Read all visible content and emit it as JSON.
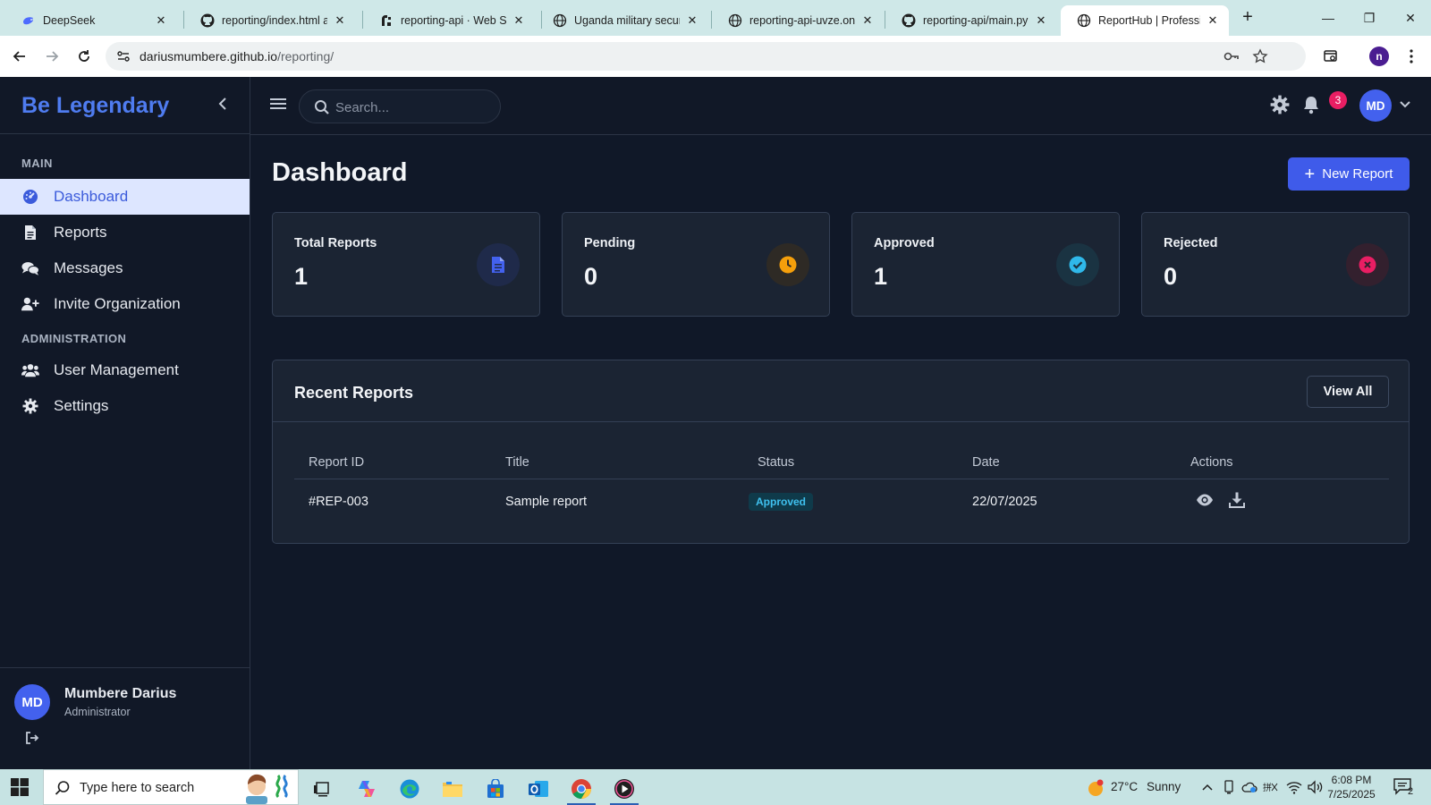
{
  "browser": {
    "tabs": [
      {
        "title": "DeepSeek",
        "icon": "deepseek-whale-icon"
      },
      {
        "title": "reporting/index.html at",
        "icon": "github-icon"
      },
      {
        "title": "reporting-api · Web Se",
        "icon": "render-icon"
      },
      {
        "title": "Uganda military securit",
        "icon": "globe-icon"
      },
      {
        "title": "reporting-api-uvze.onr",
        "icon": "globe-icon"
      },
      {
        "title": "reporting-api/main.py",
        "icon": "github-icon"
      },
      {
        "title": "ReportHub | Profession",
        "icon": "globe-icon",
        "active": true
      }
    ],
    "url_host": "dariusmumbere.github.io",
    "url_path": "/reporting/",
    "profile_initial": "n"
  },
  "sidebar": {
    "brand": "Be Legendary",
    "main_label": "MAIN",
    "admin_label": "ADMINISTRATION",
    "items": [
      {
        "label": "Dashboard",
        "icon": "dashboard-gauge-icon",
        "active": true
      },
      {
        "label": "Reports",
        "icon": "file-icon"
      },
      {
        "label": "Messages",
        "icon": "comments-icon"
      },
      {
        "label": "Invite Organization",
        "icon": "user-plus-icon"
      },
      {
        "label": "User Management",
        "icon": "users-icon"
      },
      {
        "label": "Settings",
        "icon": "gear-icon"
      }
    ],
    "user": {
      "initials": "MD",
      "name": "Mumbere Darius",
      "role": "Administrator"
    }
  },
  "topbar": {
    "search_placeholder": "Search...",
    "notification_count": "3",
    "avatar_initials": "MD"
  },
  "main": {
    "title": "Dashboard",
    "new_report_label": "New Report",
    "stats": [
      {
        "label": "Total Reports",
        "value": "1",
        "icon": "file-icon",
        "color": "#4361ee"
      },
      {
        "label": "Pending",
        "value": "0",
        "icon": "clock-icon",
        "color": "#f59f0b"
      },
      {
        "label": "Approved",
        "value": "1",
        "icon": "check-circle-icon",
        "color": "#2fb8e9"
      },
      {
        "label": "Rejected",
        "value": "0",
        "icon": "x-circle-icon",
        "color": "#e91e63"
      }
    ],
    "recent": {
      "title": "Recent Reports",
      "view_all_label": "View All",
      "columns": [
        "Report ID",
        "Title",
        "Status",
        "Date",
        "Actions"
      ],
      "rows": [
        {
          "id": "#REP-003",
          "title": "Sample report",
          "status": "Approved",
          "date": "22/07/2025"
        }
      ]
    }
  },
  "taskbar": {
    "search_placeholder": "Type here to search",
    "weather_temp": "27°C",
    "weather_desc": "Sunny",
    "time": "6:08 PM",
    "date": "7/25/2025",
    "notification_count": "2"
  },
  "colors": {
    "accent": "#4361ee",
    "background": "#101828",
    "card": "#1b2433",
    "approved": "#3fc1ef"
  }
}
